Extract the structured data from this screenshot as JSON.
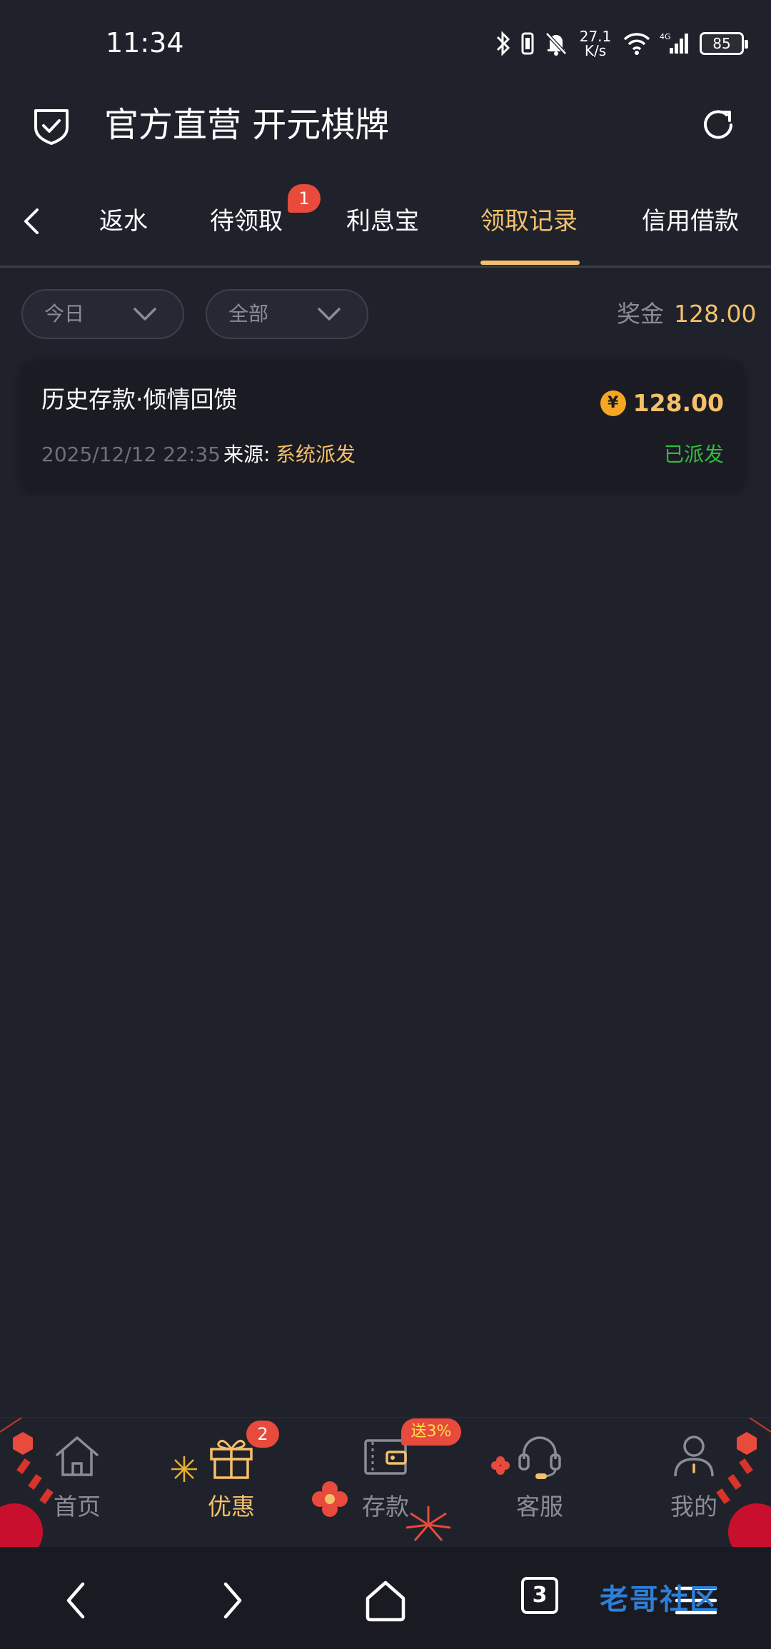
{
  "status_bar": {
    "time": "11:34",
    "speed_top": "27.1",
    "speed_bottom": "K/s",
    "battery": "85"
  },
  "header": {
    "title": "官方直营 开元棋牌"
  },
  "tabs": {
    "items": [
      {
        "label": "返水"
      },
      {
        "label": "待领取",
        "badge": "1"
      },
      {
        "label": "利息宝"
      },
      {
        "label": "领取记录",
        "active": true
      },
      {
        "label": "信用借款"
      }
    ]
  },
  "filters": {
    "date": "今日",
    "type": "全部",
    "bonus_label": "奖金",
    "bonus_value": "128.00"
  },
  "records": [
    {
      "title": "历史存款·倾情回馈",
      "amount": "128.00",
      "currency_symbol": "¥",
      "date": "2025/12/12 22:35",
      "source_label": "来源:",
      "source_value": "系统派发",
      "status": "已派发"
    }
  ],
  "bottom_nav": {
    "items": [
      {
        "label": "首页",
        "icon": "home-icon"
      },
      {
        "label": "优惠",
        "icon": "gift-icon",
        "badge": "2",
        "active": true
      },
      {
        "label": "存款",
        "icon": "wallet-icon",
        "badge": "送3%"
      },
      {
        "label": "客服",
        "icon": "headset-icon"
      },
      {
        "label": "我的",
        "icon": "user-icon"
      }
    ]
  },
  "system_nav": {
    "tab_count": "3",
    "watermark": "老哥社区"
  },
  "colors": {
    "background": "#20222b",
    "accent": "#f5c06a",
    "badge": "#e84a3c",
    "success": "#2fbf3c"
  }
}
